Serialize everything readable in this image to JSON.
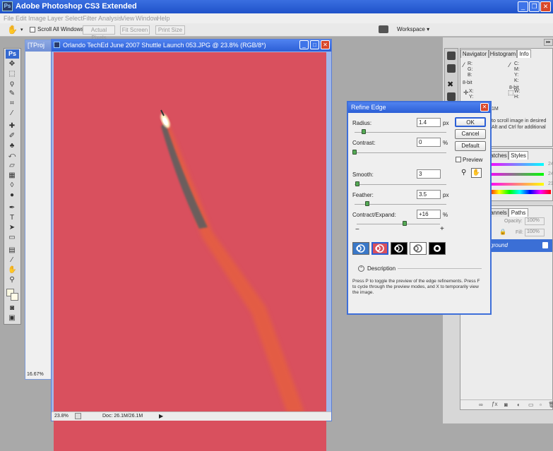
{
  "app": {
    "title": "Adobe Photoshop CS3 Extended",
    "icon": "Ps"
  },
  "menu": [
    "File",
    "Edit",
    "Image",
    "Layer",
    "Select",
    "Filter",
    "Analysis",
    "View",
    "Window",
    "Help"
  ],
  "options": {
    "scroll_all": "Scroll All Windows",
    "actual_pixels": "Actual Pixels",
    "fit_screen": "Fit Screen",
    "print_size": "Print Size",
    "workspace": "Workspace"
  },
  "toolbox": {
    "logo": "Ps"
  },
  "doc_back": {
    "title": "[TProj",
    "zoom": "16.67%"
  },
  "doc": {
    "title": "Orlando TechEd June 2007 Shuttle Launch 053.JPG @ 23.8% (RGB/8*)",
    "zoom": "23.8%",
    "doc_size": "Doc: 26.1M/26.1M"
  },
  "info_panel": {
    "tabs": [
      "Navigator",
      "Histogram",
      "Info"
    ],
    "rgb": [
      "R:",
      "G:",
      "B:"
    ],
    "cmyk": [
      "C:",
      "M:",
      "Y:",
      "K:"
    ],
    "bits": [
      "8-bit",
      "8-bit"
    ],
    "xy": [
      "X:",
      "Y:"
    ],
    "wh": [
      "W:",
      "H:"
    ],
    "help_frag1": "1M",
    "help_frag2": "to scroll image in desired",
    "help_frag3": "Alt and Ctrl for additional"
  },
  "swatches_panel": {
    "tabs": [
      "atches",
      "Styles"
    ],
    "values": [
      "249",
      "247",
      "219"
    ]
  },
  "layers_panel": {
    "tabs": [
      "annels",
      "Paths"
    ],
    "opacity_label": "Opacity:",
    "opacity": "100%",
    "fill_label": "Fill:",
    "fill": "100%",
    "layer_name": "ground"
  },
  "dialog": {
    "title": "Refine Edge",
    "radius": {
      "label": "Radius:",
      "value": "1.4",
      "unit": "px",
      "level": 0.1
    },
    "contrast": {
      "label": "Contrast:",
      "value": "0",
      "unit": "%",
      "level": 0.0
    },
    "smooth": {
      "label": "Smooth:",
      "value": "3",
      "level": 0.03
    },
    "feather": {
      "label": "Feather:",
      "value": "3.5",
      "unit": "px",
      "level": 0.14
    },
    "contract": {
      "label": "Contract/Expand:",
      "value": "+16",
      "unit": "%",
      "level": 0.58
    },
    "minus": "−",
    "plus": "+",
    "ok": "OK",
    "cancel": "Cancel",
    "default": "Default",
    "preview": "Preview",
    "description": "Description",
    "help": "Press P to toggle the preview of the edge refinements. Press F to cycle through the preview modes, and X to temporarily view the image."
  }
}
